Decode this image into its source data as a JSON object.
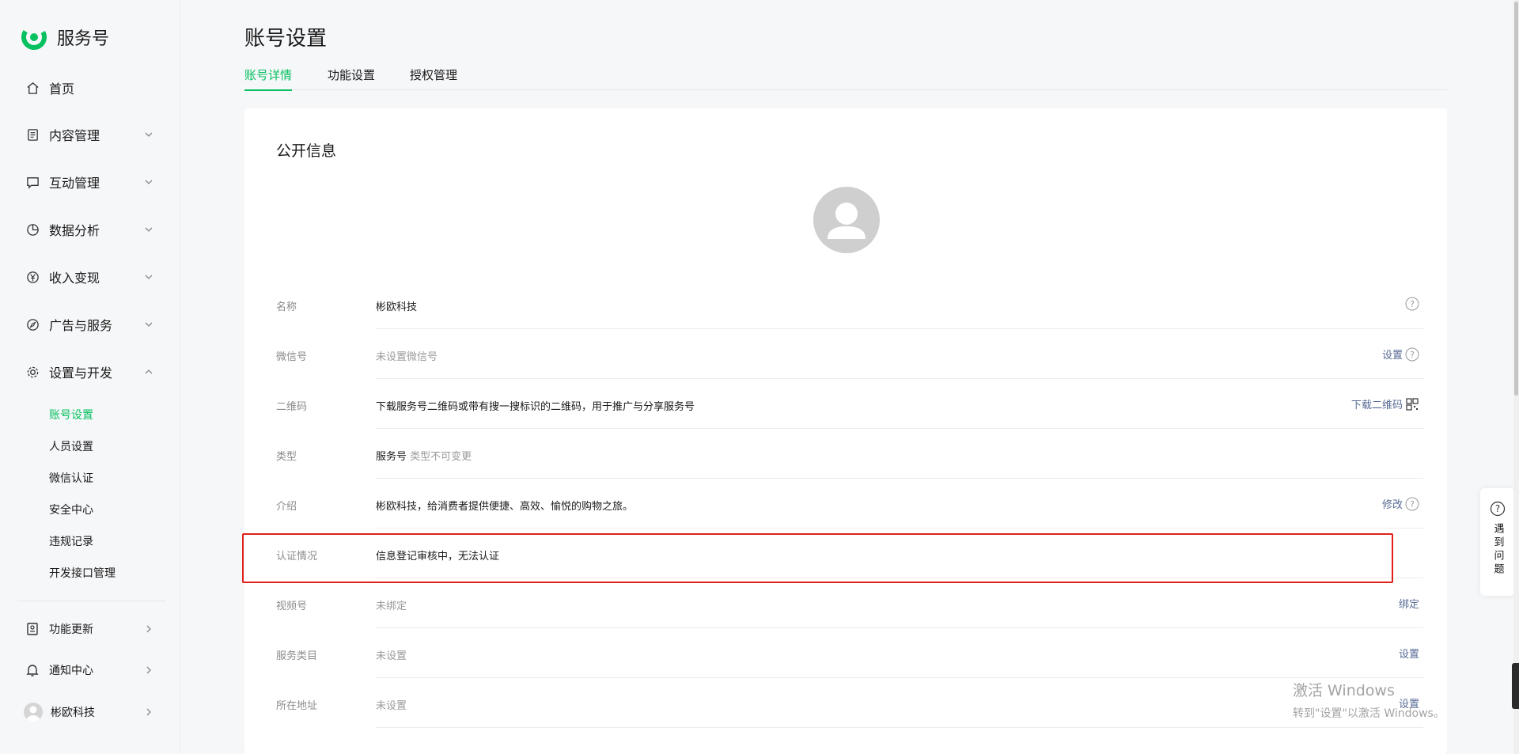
{
  "brand": {
    "name": "服务号"
  },
  "sidebar": {
    "items": [
      {
        "label": "首页",
        "icon": "home-icon"
      },
      {
        "label": "内容管理",
        "icon": "document-icon"
      },
      {
        "label": "互动管理",
        "icon": "chat-icon"
      },
      {
        "label": "数据分析",
        "icon": "pie-chart-icon"
      },
      {
        "label": "收入变现",
        "icon": "yen-icon"
      },
      {
        "label": "广告与服务",
        "icon": "compass-icon"
      },
      {
        "label": "设置与开发",
        "icon": "gear-icon"
      }
    ],
    "sub_items": [
      "账号设置",
      "人员设置",
      "微信认证",
      "安全中心",
      "违规记录",
      "开发接口管理"
    ],
    "bottom_items": [
      {
        "label": "功能更新",
        "icon": "update-icon"
      },
      {
        "label": "通知中心",
        "icon": "bell-icon"
      },
      {
        "label": "彬欧科技",
        "icon": "avatar"
      }
    ]
  },
  "header": {
    "title": "账号设置"
  },
  "tabs": [
    "账号详情",
    "功能设置",
    "授权管理"
  ],
  "section": {
    "title": "公开信息"
  },
  "rows": [
    {
      "label": "名称",
      "value": "彬欧科技"
    },
    {
      "label": "微信号",
      "value": "未设置微信号",
      "action": "设置"
    },
    {
      "label": "二维码",
      "value": "下载服务号二维码或带有搜一搜标识的二维码，用于推广与分享服务号",
      "action": "下载二维码"
    },
    {
      "label": "类型",
      "value": "服务号",
      "sub": "类型不可变更"
    },
    {
      "label": "介绍",
      "value": "彬欧科技，给消费者提供便捷、高效、愉悦的购物之旅。",
      "action": "修改"
    },
    {
      "label": "认证情况",
      "value": "信息登记审核中，无法认证"
    },
    {
      "label": "视频号",
      "value": "未绑定",
      "action": "绑定"
    },
    {
      "label": "服务类目",
      "value": "未设置",
      "action": "设置"
    },
    {
      "label": "所在地址",
      "value": "未设置",
      "action": "设置"
    }
  ],
  "help": {
    "label": "遇到问题"
  },
  "watermark": {
    "line1": "激活 Windows",
    "line2": "转到\"设置\"以激活 Windows。"
  },
  "colors": {
    "accent": "#07c160",
    "link": "#576b95",
    "highlight": "#e0201a"
  }
}
